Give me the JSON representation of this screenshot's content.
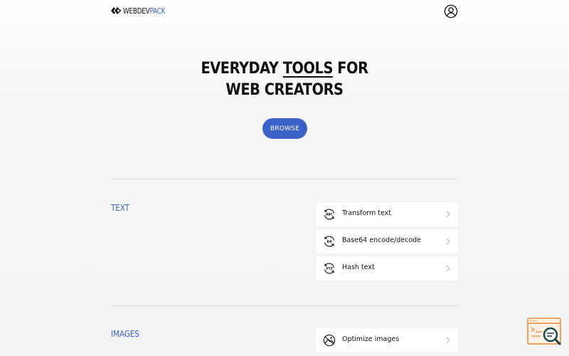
{
  "header": {
    "logo_part1": "WEBDEV",
    "logo_part2": "PACK",
    "account_icon": "user-circle-icon"
  },
  "hero": {
    "line1_before": "EVERYDAY ",
    "line1_underlined": "TOOLS",
    "line1_after": " FOR",
    "line2": "WEB CREATORS",
    "browse_label": "BROWSE"
  },
  "sections": [
    {
      "title": "TEXT",
      "items": [
        {
          "label": "Transform text",
          "icon": "abc-cycle-icon",
          "icon_text": "ABC"
        },
        {
          "label": "Base64 encode/decode",
          "icon": "base64-cycle-icon",
          "icon_text": "64"
        },
        {
          "label": "Hash text",
          "icon": "xyz-cycle-icon",
          "icon_text": "XYZ"
        }
      ]
    },
    {
      "title": "IMAGES",
      "items": [
        {
          "label": "Optimize images",
          "icon": "image-optimize-icon"
        }
      ]
    }
  ],
  "colors": {
    "accent": "#3a62c9",
    "widget": "#f0a060"
  }
}
